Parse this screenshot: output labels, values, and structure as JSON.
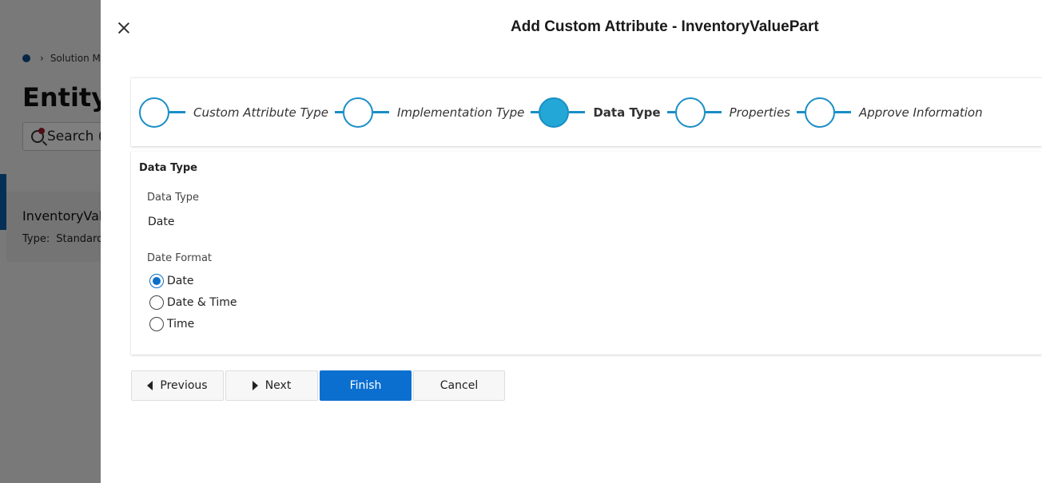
{
  "background": {
    "breadcrumb": "Solution M",
    "title": "Entity",
    "search_label": "Search (",
    "card_name": "InventoryVal",
    "card_type_label": "Type:",
    "card_type_value": "Standard"
  },
  "panel": {
    "title": "Add Custom Attribute - InventoryValuePart"
  },
  "stepper": {
    "steps": [
      {
        "label": "Custom Attribute Type",
        "active": false
      },
      {
        "label": "Implementation Type",
        "active": false
      },
      {
        "label": "Data Type",
        "active": true
      },
      {
        "label": "Properties",
        "active": false
      },
      {
        "label": "Approve Information",
        "active": false
      }
    ]
  },
  "section": {
    "title": "Data Type",
    "data_type_label": "Data Type",
    "data_type_value": "Date",
    "date_format_label": "Date Format",
    "options": [
      {
        "label": "Date",
        "checked": true
      },
      {
        "label": "Date & Time",
        "checked": false
      },
      {
        "label": "Time",
        "checked": false
      }
    ]
  },
  "buttons": {
    "previous": "Previous",
    "next": "Next",
    "finish": "Finish",
    "cancel": "Cancel"
  },
  "colors": {
    "accent": "#1a8ec5",
    "active_step": "#23a7d7",
    "primary_button": "#0b6fd0"
  }
}
